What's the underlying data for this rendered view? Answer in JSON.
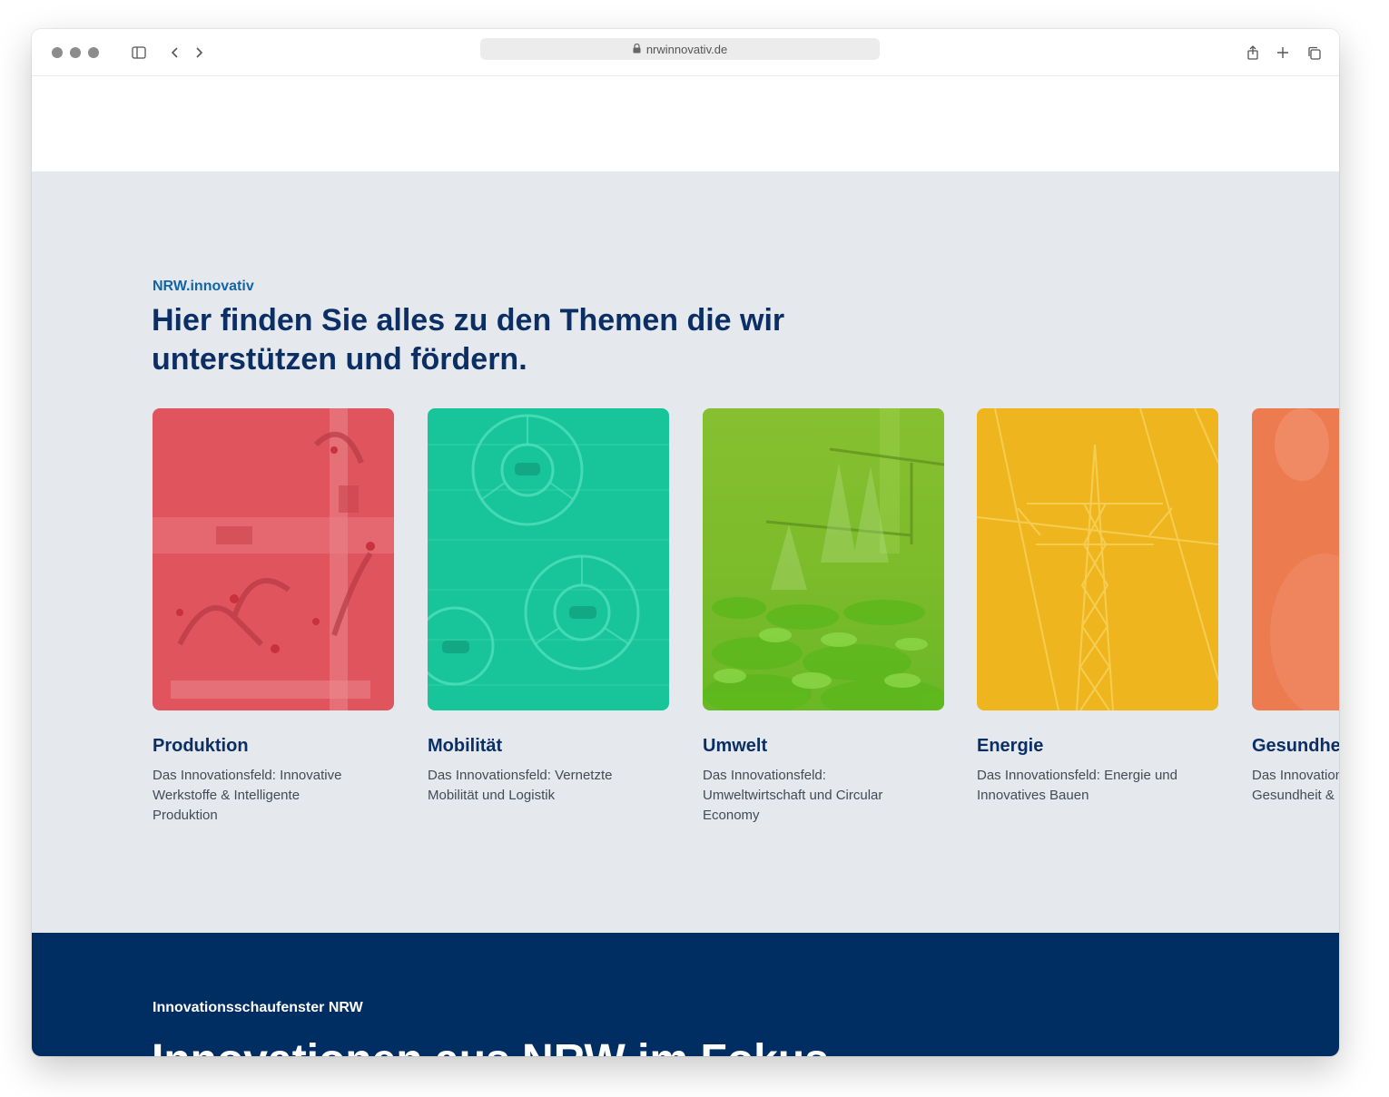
{
  "browser": {
    "url": "nrwinnovativ.de"
  },
  "section": {
    "eyebrow": "NRW.innovativ",
    "headline": "Hier finden Sie alles zu den Themen die wir unterstützen und fördern."
  },
  "cards": [
    {
      "title": "Produktion",
      "description": "Das Innovationsfeld: Innovative Werkstoffe & Intelligente Produktion",
      "color": "#e0545e"
    },
    {
      "title": "Mobilität",
      "description": "Das Innovationsfeld: Vernetzte Mobilität und Logistik",
      "color": "#18c59a"
    },
    {
      "title": "Umwelt",
      "description": "Das Innovationsfeld: Umweltwirtschaft und Circular Economy",
      "color": "#7cc02e"
    },
    {
      "title": "Energie",
      "description": "Das Innovationsfeld: Energie und Innovatives Bauen",
      "color": "#efb51f"
    },
    {
      "title": "Gesundheit",
      "description": "Das Innovationsfeld: Medizin, Gesundheit & Life Science",
      "color": "#ec7b50"
    }
  ],
  "showcase": {
    "eyebrow": "Innovationsschaufenster NRW",
    "headline": "Innovationen aus NRW im Fokus"
  },
  "colors": {
    "section_background": "#e5e9ed",
    "headline_blue": "#0b2f64",
    "accent_blue": "#1464a5",
    "footer_blue": "#002d62"
  }
}
